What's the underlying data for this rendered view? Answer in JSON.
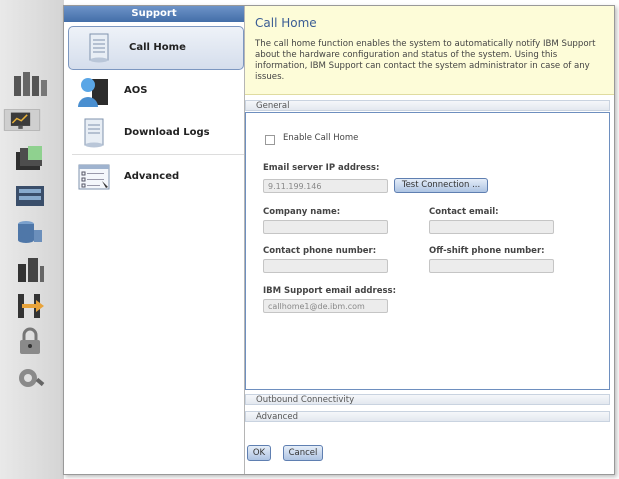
{
  "rail": {
    "icons": [
      "servers-icon",
      "monitoring-icon",
      "folders-icon",
      "storage-controller-icon",
      "volumes-icon",
      "hosts-icon",
      "copy-services-icon",
      "access-lock-icon",
      "settings-icon"
    ]
  },
  "support_panel": {
    "header": "Support",
    "items": [
      {
        "label": "Call Home",
        "icon": "call-home-icon",
        "selected": true
      },
      {
        "label": "AOS",
        "icon": "aos-user-icon",
        "selected": false
      },
      {
        "label": "Download Logs",
        "icon": "download-logs-icon",
        "selected": false
      },
      {
        "label": "Advanced",
        "icon": "advanced-checklist-icon",
        "selected": false
      }
    ]
  },
  "call_home": {
    "title": "Call Home",
    "description": "The call home function enables the system to automatically notify IBM Support about the hardware configuration and status of the system. Using this information, IBM Support can contact the system administrator in case of any issues.",
    "sections": {
      "general": "General",
      "outbound": "Outbound Connectivity",
      "advanced": "Advanced"
    },
    "enable_label": "Enable Call Home",
    "enable_checked": false,
    "email_server_label": "Email server IP address:",
    "email_server_value": "9.11.199.146",
    "test_connection_label": "Test Connection ...",
    "company_name_label": "Company name:",
    "company_name_value": "",
    "contact_email_label": "Contact email:",
    "contact_email_value": "",
    "contact_phone_label": "Contact phone number:",
    "contact_phone_value": "",
    "offshift_phone_label": "Off-shift phone number:",
    "offshift_phone_value": "",
    "ibm_support_email_label": "IBM Support email address:",
    "ibm_support_email_value": "callhome1@de.ibm.com"
  },
  "actions": {
    "ok": "OK",
    "cancel": "Cancel"
  },
  "colors": {
    "accent": "#4a74ae",
    "info_background": "#fdfcd8",
    "section_border": "#6e8fbf"
  }
}
